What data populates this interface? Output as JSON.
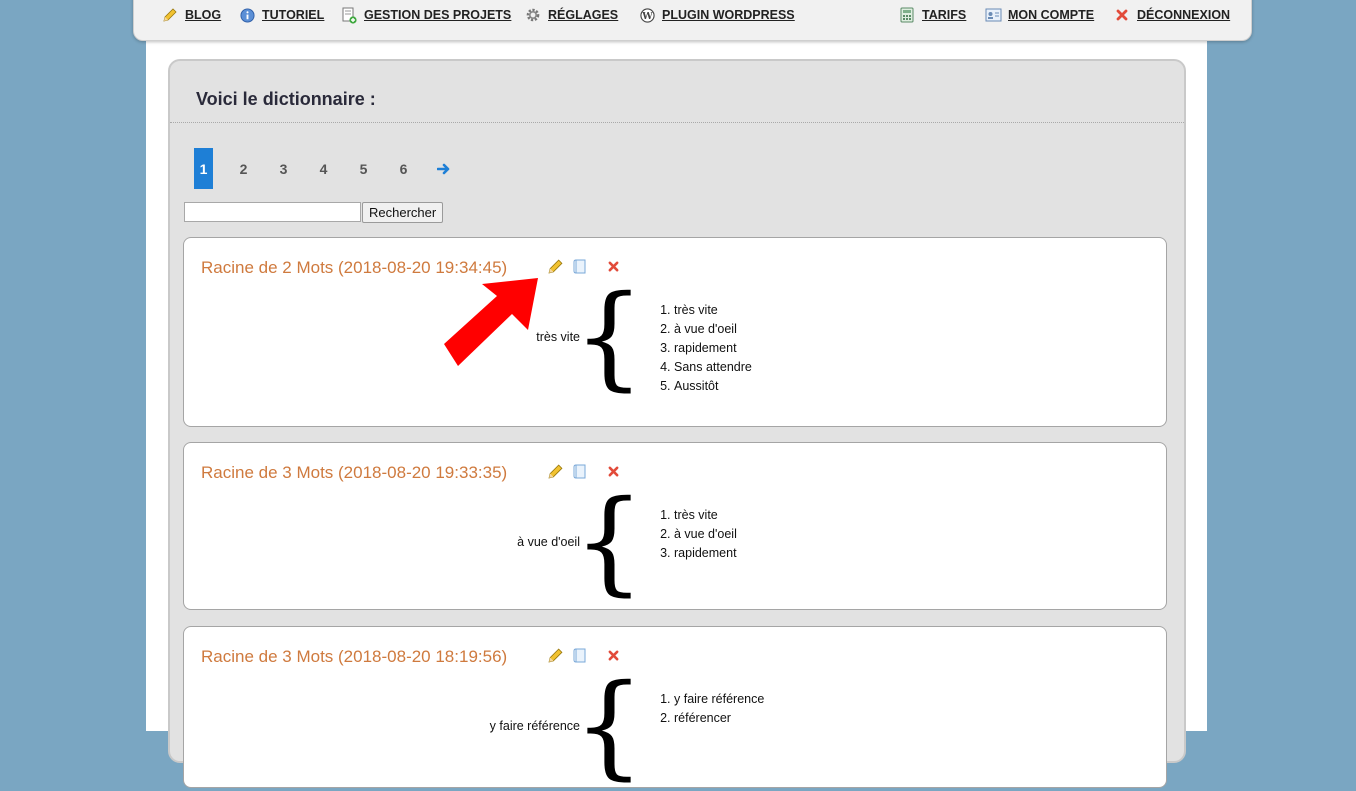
{
  "nav": {
    "left": [
      {
        "label": "BLOG",
        "icon": "pencil-icon"
      },
      {
        "label": "TUTORIEL",
        "icon": "info-icon"
      },
      {
        "label": "GESTION DES PROJETS",
        "icon": "add-document-icon"
      },
      {
        "label": "RÉGLAGES",
        "icon": "gear-icon"
      },
      {
        "label": "PLUGIN WORDPRESS",
        "icon": "wordpress-icon"
      }
    ],
    "right": [
      {
        "label": "TARIFS",
        "icon": "calculator-icon"
      },
      {
        "label": "MON COMPTE",
        "icon": "id-card-icon"
      },
      {
        "label": "DÉCONNEXION",
        "icon": "close-icon"
      }
    ]
  },
  "panel": {
    "title": "Voici le dictionnaire :"
  },
  "pagination": {
    "pages": [
      "1",
      "2",
      "3",
      "4",
      "5",
      "6"
    ],
    "active": "1",
    "next_icon": "arrow-right-icon"
  },
  "search": {
    "value": "",
    "button_label": "Rechercher"
  },
  "entries": [
    {
      "title": "Racine de 2 Mots (2018-08-20 19:34:45)",
      "root": "très vite",
      "synonyms": [
        "très vite",
        "à vue d'oeil",
        "rapidement",
        "Sans attendre",
        "Aussitôt"
      ]
    },
    {
      "title": "Racine de 3 Mots (2018-08-20 19:33:35)",
      "root": "à vue d'oeil",
      "synonyms": [
        "très vite",
        "à vue d'oeil",
        "rapidement"
      ]
    },
    {
      "title": "Racine de 3 Mots (2018-08-20 18:19:56)",
      "root": "y faire référence",
      "synonyms": [
        "y faire référence",
        "référencer"
      ]
    }
  ],
  "entry_actions": [
    "edit-pencil-icon",
    "copy-document-icon",
    "delete-icon"
  ],
  "colors": {
    "background": "#7aa6c2",
    "accent": "#1e7fd6",
    "entry_title": "#cf7a3e",
    "annotation_arrow": "#ff0000"
  }
}
